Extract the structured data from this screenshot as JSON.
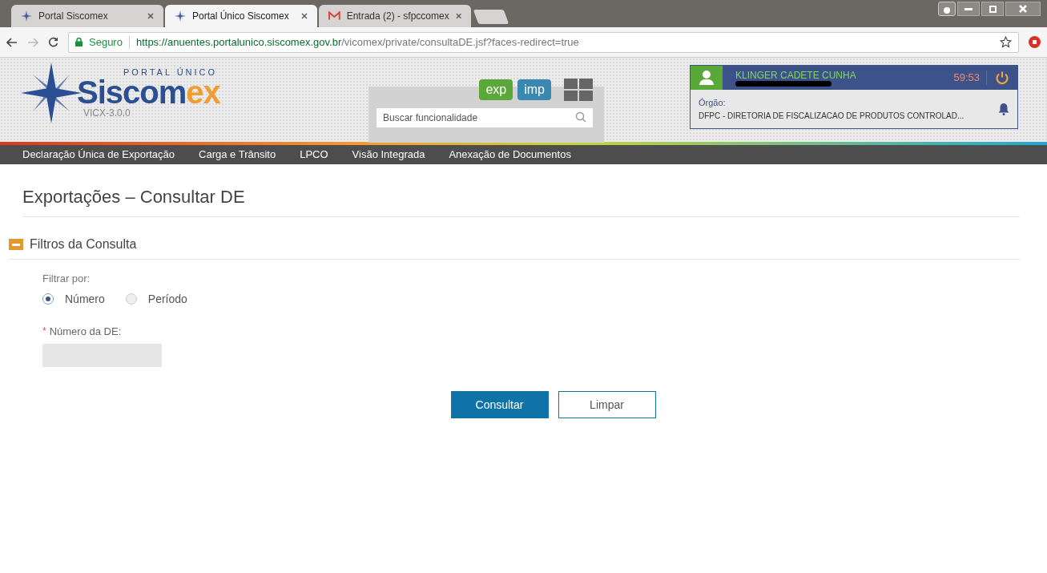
{
  "browser": {
    "tabs": [
      {
        "title": "Portal Siscomex",
        "kind": "site",
        "selected": false
      },
      {
        "title": "Portal Único Siscomex",
        "kind": "site",
        "selected": true
      },
      {
        "title": "Entrada (2) - sfpccomex",
        "kind": "mail",
        "selected": false
      }
    ],
    "secure_label": "Seguro",
    "url_host": "https://anuentes.portalunico.siscomex.gov.br",
    "url_path": "/vicomex/private/consultaDE.jsf?faces-redirect=true"
  },
  "header": {
    "logo_top": "PORTAL ÚNICO",
    "logo_main": "Siscom",
    "logo_accent": "ex",
    "version": "VICX-3.0.0",
    "mode_buttons": [
      {
        "label": "exp",
        "color": "#5aa83a"
      },
      {
        "label": "imp",
        "color": "#3a87b0"
      }
    ],
    "search": {
      "placeholder": "Buscar funcionalidade"
    },
    "user": {
      "name": "KLINGER CADETE CUNHA",
      "timer": "59:53",
      "org_label": "Órgão:",
      "org_value": "DFPC - DIRETORIA DE FISCALIZACAO DE PRODUTOS CONTROLAD..."
    }
  },
  "nav": [
    "Declaração Única de Exportação",
    "Carga e Trânsito",
    "LPCO",
    "Visão Integrada",
    "Anexação de Documentos"
  ],
  "page": {
    "title": "Exportações – Consultar DE",
    "section": {
      "title": "Filtros da Consulta",
      "expanded": true
    },
    "filter_label": "Filtrar por:",
    "filter_options": [
      {
        "label": "Número",
        "selected": true
      },
      {
        "label": "Período",
        "selected": false
      }
    ],
    "required_mark": "*",
    "field_label": "Número da DE:",
    "buttons": [
      {
        "label": "Consultar",
        "kind": "primary"
      },
      {
        "label": "Limpar",
        "kind": "secondary"
      }
    ]
  }
}
